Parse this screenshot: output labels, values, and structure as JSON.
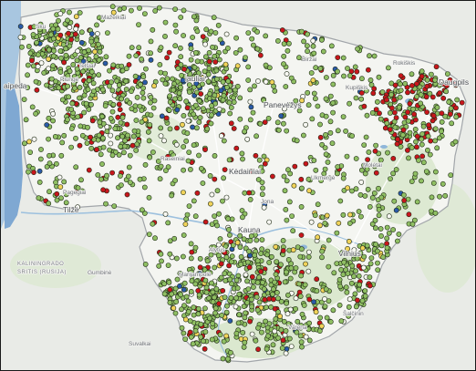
{
  "map": {
    "labels": {
      "klaipeda": "aipeda",
      "skuodas": "Sku",
      "mazeikiai": "Mažeikiai",
      "plunge": "Plungė",
      "telsiai": "Telšiai",
      "kretinga": "Kretinga",
      "siauliai": "iauliai",
      "birzai": "Biržai",
      "kupiskis": "Kupiškis",
      "panevezys": "Panevėžys",
      "rokiskis": "Rokiškis",
      "daugpils": "Daugpils",
      "raseiniai": "Raseiniai",
      "kedainiai": "Kėdainiai",
      "jonava": "Jona",
      "kaunas": "Kauna",
      "vilnius": "Vilnius",
      "tilze": "Tilžė",
      "pagegiai": "Pagėgiai",
      "kaliningrado": "KALININGRADO",
      "sritis": "SRITIS (RUSIJA)",
      "gumbine": "Gumbinė",
      "suvalkai": "Suvalkai",
      "varena": "Varėna",
      "salcininkai": "Šalčinin",
      "ukmerge": "Ukmergė",
      "alytus": "Alytus",
      "marijampole": "Marijampolė",
      "moletai": "Molėtai"
    },
    "marker_colors": {
      "green": "#8fbf63",
      "red": "#c8161c",
      "blue": "#2a5aa8",
      "yellow": "#f1d35a",
      "white": "#f7f7f2"
    },
    "base_colors": {
      "land": "#eceeea",
      "lithuania": "#f3f4f1",
      "forest": "#d6e6c9",
      "sea": "#a8c6e0",
      "lagoon": "#8fb6d9",
      "border": "#a2a6aa"
    }
  }
}
